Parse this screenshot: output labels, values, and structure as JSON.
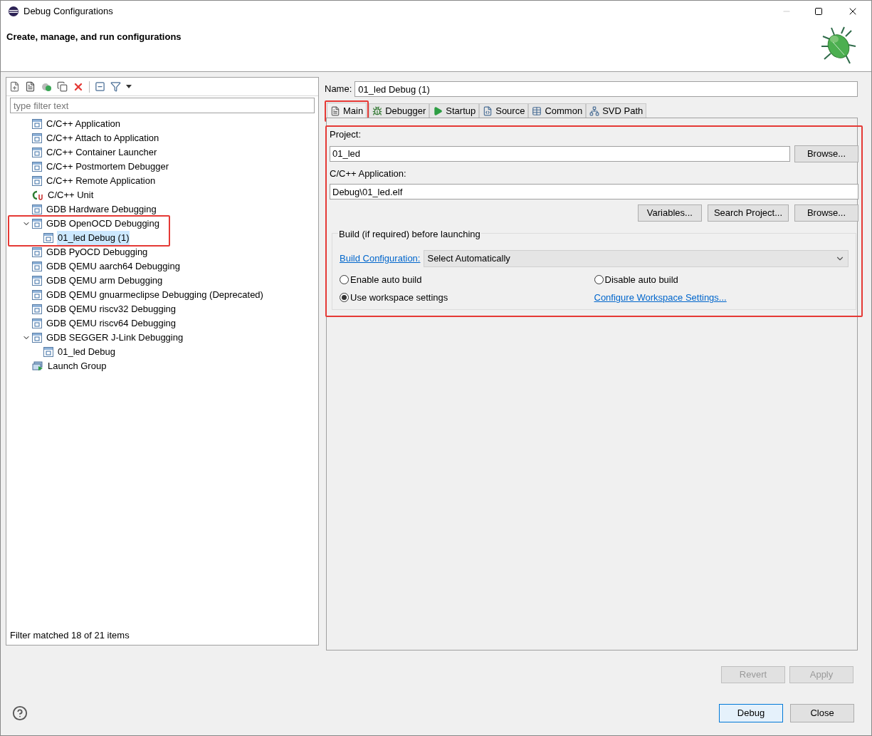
{
  "window": {
    "title": "Debug Configurations"
  },
  "header": {
    "subtitle": "Create, manage, and run configurations"
  },
  "filter": {
    "placeholder": "type filter text"
  },
  "tree": [
    {
      "label": "C/C++ Application",
      "kind": "config",
      "selected": false
    },
    {
      "label": "C/C++ Attach to Application",
      "kind": "config",
      "selected": false
    },
    {
      "label": "C/C++ Container Launcher",
      "kind": "config",
      "selected": false
    },
    {
      "label": "C/C++ Postmortem Debugger",
      "kind": "config",
      "selected": false
    },
    {
      "label": "C/C++ Remote Application",
      "kind": "config",
      "selected": false
    },
    {
      "label": "C/C++ Unit",
      "kind": "unit",
      "selected": false
    },
    {
      "label": "GDB Hardware Debugging",
      "kind": "config",
      "selected": false
    },
    {
      "label": "GDB OpenOCD Debugging",
      "kind": "config",
      "expanded": true,
      "selected": false,
      "highlighted": true,
      "children": [
        {
          "label": "01_led Debug (1)",
          "kind": "config",
          "selected": true
        }
      ]
    },
    {
      "label": "GDB PyOCD Debugging",
      "kind": "config",
      "selected": false
    },
    {
      "label": "GDB QEMU aarch64 Debugging",
      "kind": "config",
      "selected": false
    },
    {
      "label": "GDB QEMU arm Debugging",
      "kind": "config",
      "selected": false
    },
    {
      "label": "GDB QEMU gnuarmeclipse Debugging (Deprecated)",
      "kind": "config",
      "selected": false
    },
    {
      "label": "GDB QEMU riscv32 Debugging",
      "kind": "config",
      "selected": false
    },
    {
      "label": "GDB QEMU riscv64 Debugging",
      "kind": "config",
      "selected": false
    },
    {
      "label": "GDB SEGGER J-Link Debugging",
      "kind": "config",
      "expanded": true,
      "selected": false,
      "children": [
        {
          "label": "01_led Debug",
          "kind": "config",
          "selected": false
        }
      ]
    },
    {
      "label": "Launch Group",
      "kind": "group",
      "selected": false
    }
  ],
  "filter_status": "Filter matched 18 of 21 items",
  "name": {
    "label": "Name:",
    "value": "01_led Debug (1)"
  },
  "tabs": [
    {
      "label": "Main",
      "selected": true,
      "highlighted": true
    },
    {
      "label": "Debugger",
      "selected": false,
      "highlighted": false
    },
    {
      "label": "Startup",
      "selected": false,
      "highlighted": false
    },
    {
      "label": "Source",
      "selected": false,
      "highlighted": false
    },
    {
      "label": "Common",
      "selected": false,
      "highlighted": false
    },
    {
      "label": "SVD Path",
      "selected": false,
      "highlighted": false
    }
  ],
  "main": {
    "highlighted": true,
    "project_label": "Project:",
    "project_value": "01_led",
    "project_browse": "Browse...",
    "app_label": "C/C++ Application:",
    "app_value": "Debug\\01_led.elf",
    "app_buttons": [
      "Variables...",
      "Search Project...",
      "Browse..."
    ],
    "build_title": "Build (if required) before launching",
    "build_config_link": "Build Configuration:",
    "build_config_value": "Select Automatically",
    "radios": [
      {
        "label": "Enable auto build",
        "selected": false
      },
      {
        "label": "Disable auto build",
        "selected": false
      },
      {
        "label": "Use workspace settings",
        "selected": true
      }
    ],
    "configure_link": "Configure Workspace Settings..."
  },
  "actions": [
    {
      "label": "Revert",
      "disabled": true
    },
    {
      "label": "Apply",
      "disabled": true
    }
  ],
  "dialog_buttons": [
    {
      "label": "Debug",
      "focused": true
    },
    {
      "label": "Close",
      "focused": false
    }
  ]
}
